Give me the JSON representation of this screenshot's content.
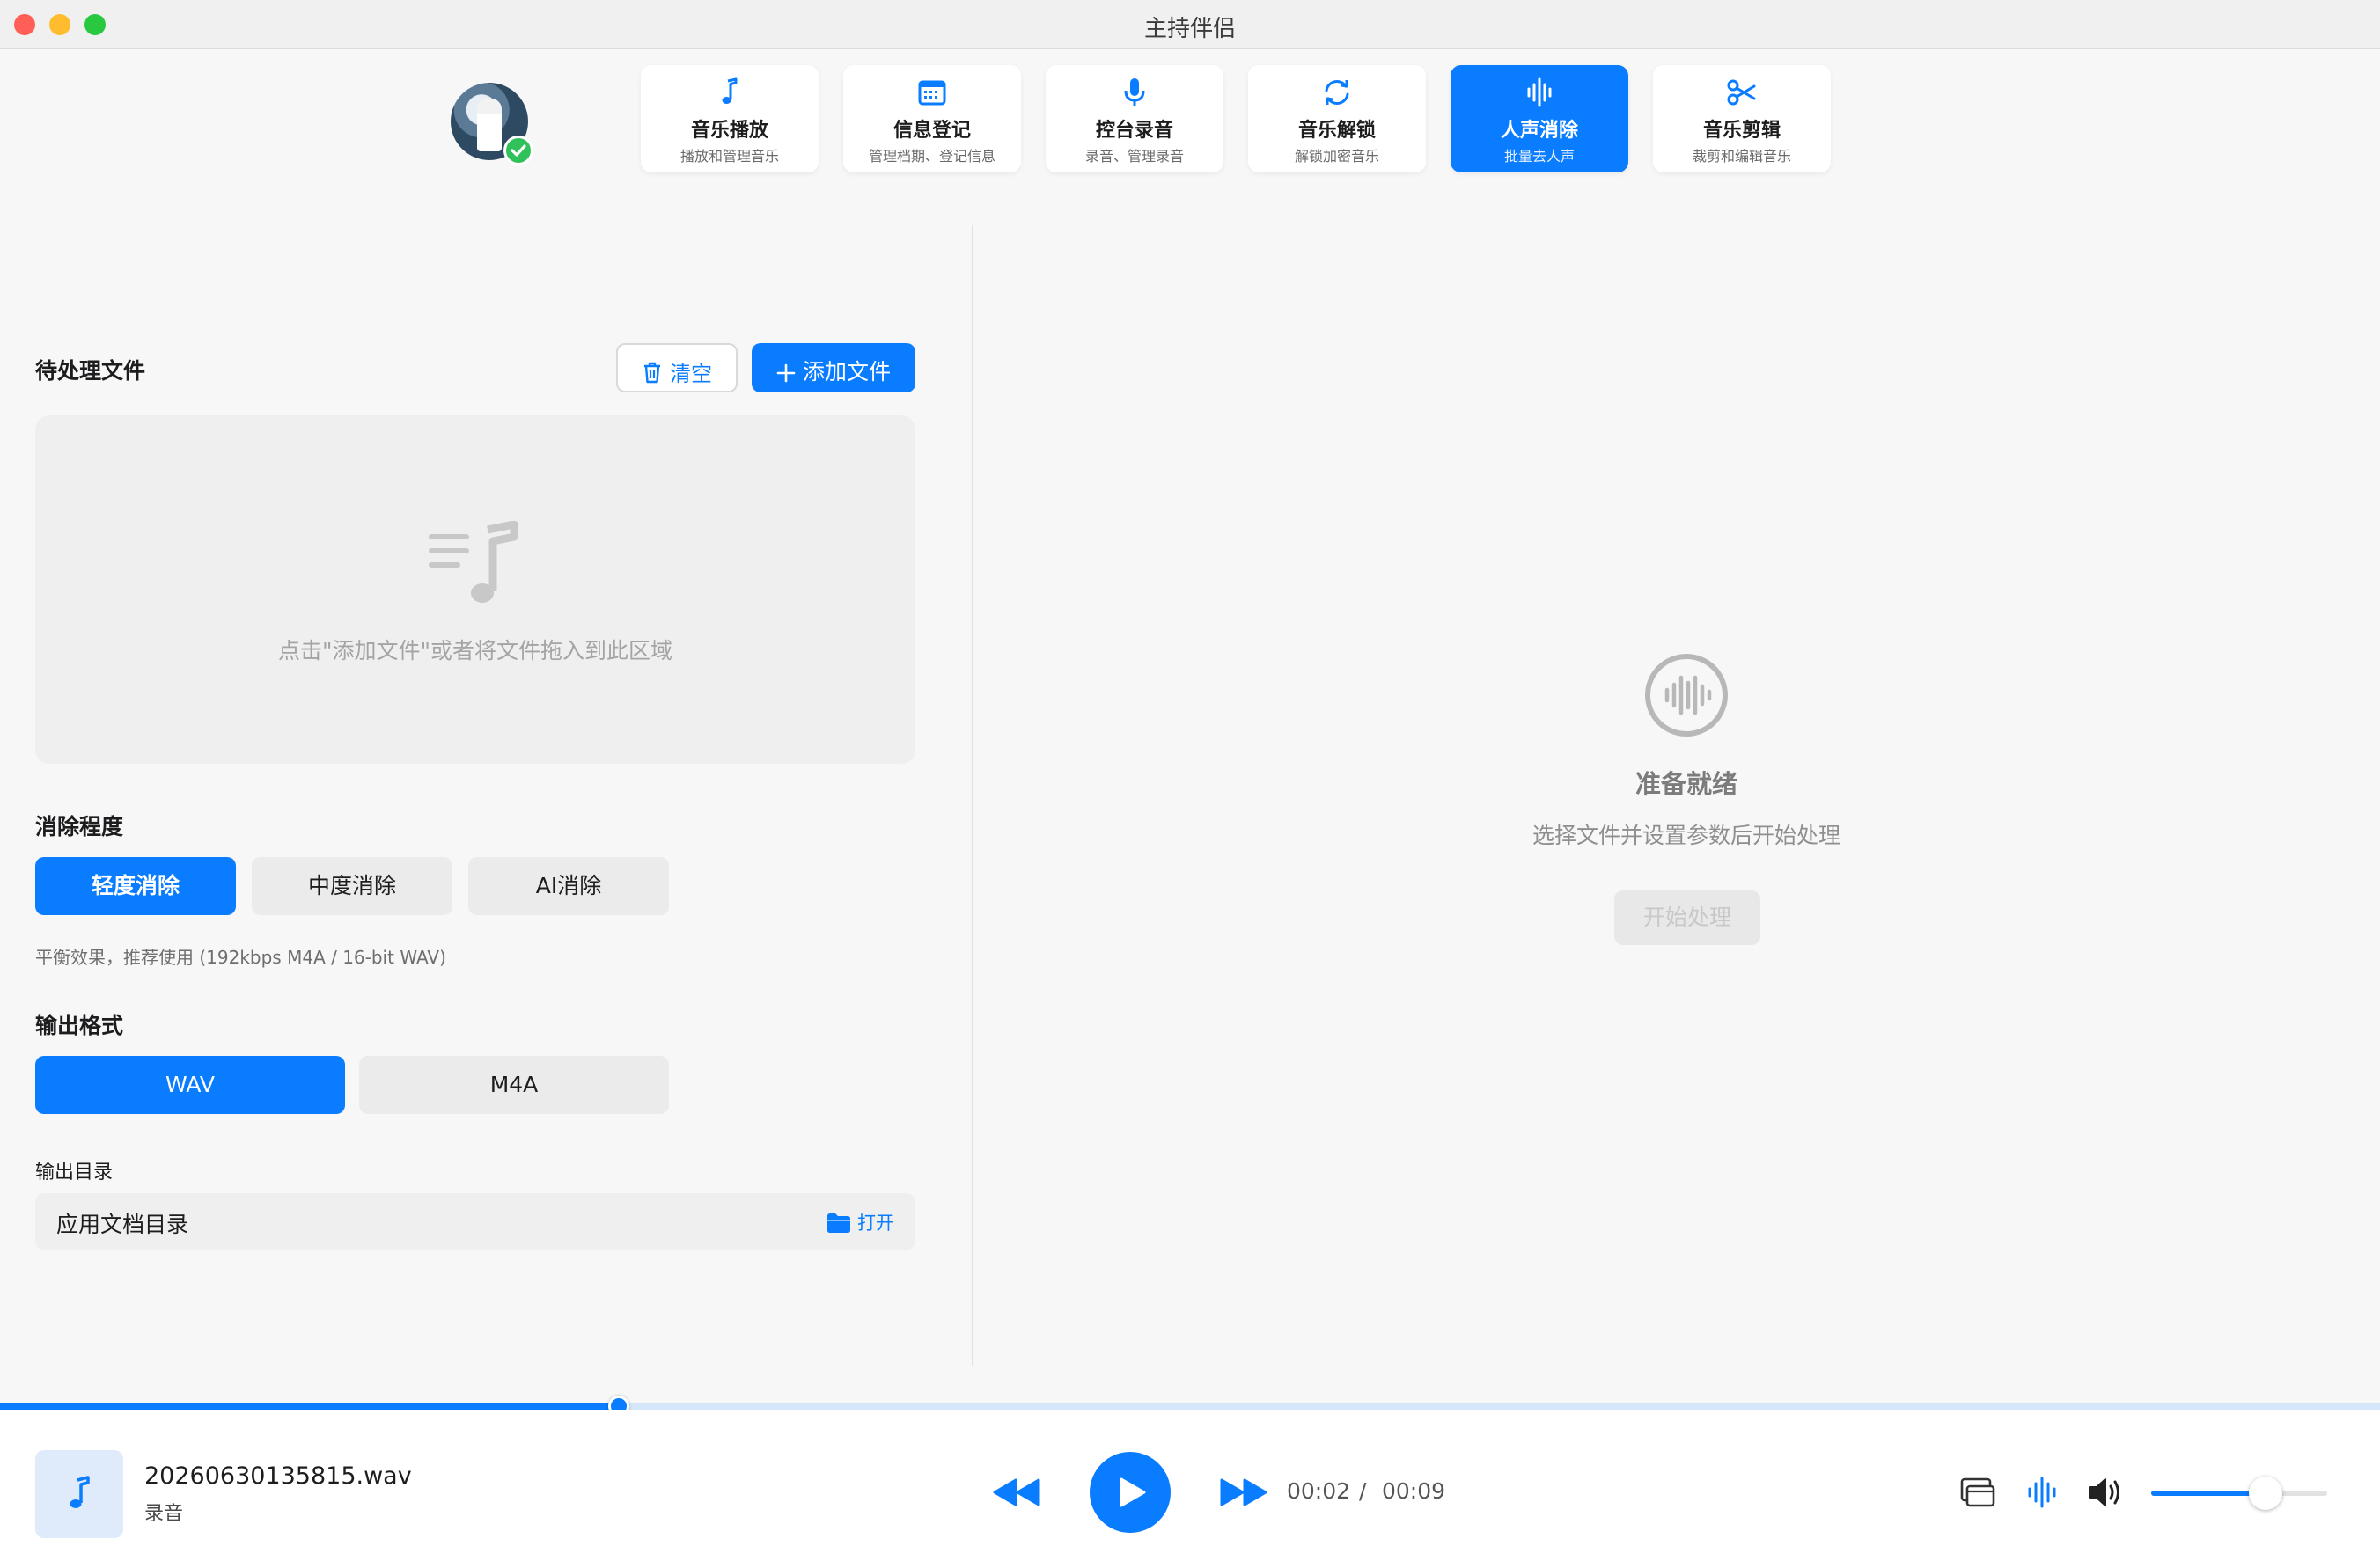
{
  "window": {
    "title": "主持伴侣"
  },
  "tabs": [
    {
      "label": "音乐播放",
      "sub": "播放和管理音乐",
      "icon": "music-note-icon",
      "active": false
    },
    {
      "label": "信息登记",
      "sub": "管理档期、登记信息",
      "icon": "calendar-icon",
      "active": false
    },
    {
      "label": "控台录音",
      "sub": "录音、管理录音",
      "icon": "microphone-icon",
      "active": false
    },
    {
      "label": "音乐解锁",
      "sub": "解锁加密音乐",
      "icon": "refresh-icon",
      "active": false
    },
    {
      "label": "人声消除",
      "sub": "批量去人声",
      "icon": "waveform-icon",
      "active": true
    },
    {
      "label": "音乐剪辑",
      "sub": "裁剪和编辑音乐",
      "icon": "scissors-icon",
      "active": false
    }
  ],
  "pending": {
    "title": "待处理文件",
    "clear_label": "清空",
    "add_label": "添加文件",
    "drop_hint": "点击\"添加文件\"或者将文件拖入到此区域"
  },
  "removal": {
    "title": "消除程度",
    "options": [
      "轻度消除",
      "中度消除",
      "AI消除"
    ],
    "selected": "轻度消除",
    "hint": "平衡效果，推荐使用 (192kbps M4A / 16-bit WAV)"
  },
  "format": {
    "title": "输出格式",
    "options": [
      "WAV",
      "M4A"
    ],
    "selected": "WAV"
  },
  "output_dir": {
    "title": "输出目录",
    "value": "应用文档目录",
    "open_label": "打开"
  },
  "status": {
    "title": "准备就绪",
    "subtitle": "选择文件并设置参数后开始处理",
    "start_label": "开始处理"
  },
  "player": {
    "track_name": "20260630135815.wav",
    "track_sub": "录音",
    "elapsed": "00:02",
    "separator": "/",
    "duration": "00:09",
    "progress": 0.26,
    "volume": 0.65
  },
  "colors": {
    "accent": "#0a7cff",
    "check_green": "#30c15a"
  }
}
